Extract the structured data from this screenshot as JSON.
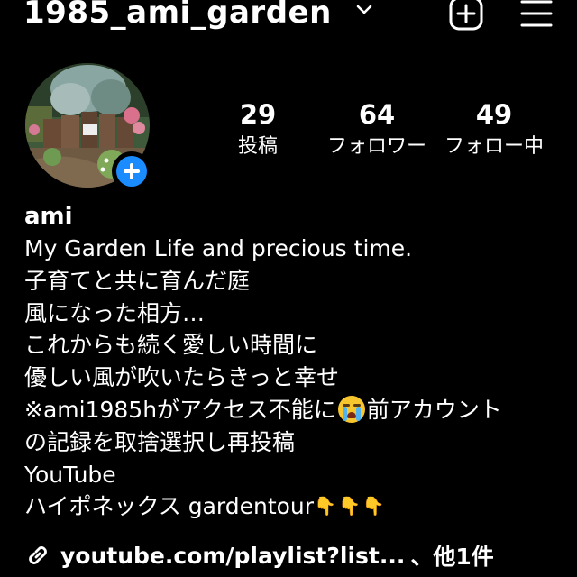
{
  "header": {
    "username": "1985_ami_garden",
    "switch_account_icon": "chevron-down-icon",
    "create_icon": "plus-square-icon",
    "menu_icon": "hamburger-menu-icon"
  },
  "profile": {
    "avatar_alt": "garden-photo",
    "add_story_icon": "plus-circle-icon",
    "accent_color": "#1a8cff"
  },
  "stats": {
    "posts": {
      "count": "29",
      "label": "投稿"
    },
    "followers": {
      "count": "64",
      "label": "フォロワー"
    },
    "following": {
      "count": "49",
      "label": "フォロー中"
    }
  },
  "bio": {
    "name": "ami",
    "line1": "My Garden Life and precious time.",
    "line2": "子育てと共に育んだ庭",
    "line3": "風になった相方…",
    "line4": "これからも続く愛しい時間に",
    "line5": "優しい風が吹いたらきっと幸せ",
    "line6_before": "※ami1985hがアクセス不能に",
    "line6_emoji": "crying-face-emoji",
    "line6_after": "前アカウント",
    "line7": "の記録を取捨選択し再投稿",
    "line8": "YouTube",
    "line9_text": "ハイポネックス gardentour",
    "line9_emojis": "👇👇👇"
  },
  "link": {
    "icon": "link-icon",
    "url": "youtube.com/playlist?list...",
    "more": "、他1件"
  }
}
